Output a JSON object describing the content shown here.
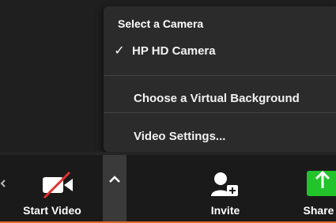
{
  "menu": {
    "section_title": "Select a Camera",
    "camera_item": {
      "check": "✓",
      "label": "HP HD Camera"
    },
    "virtual_background": "Choose a Virtual Background",
    "video_settings": "Video Settings..."
  },
  "toolbar": {
    "start_video": "Start Video",
    "invite": "Invite",
    "share": "Share"
  },
  "colors": {
    "share_green": "#22c32b",
    "mute_red": "#e0322f"
  }
}
